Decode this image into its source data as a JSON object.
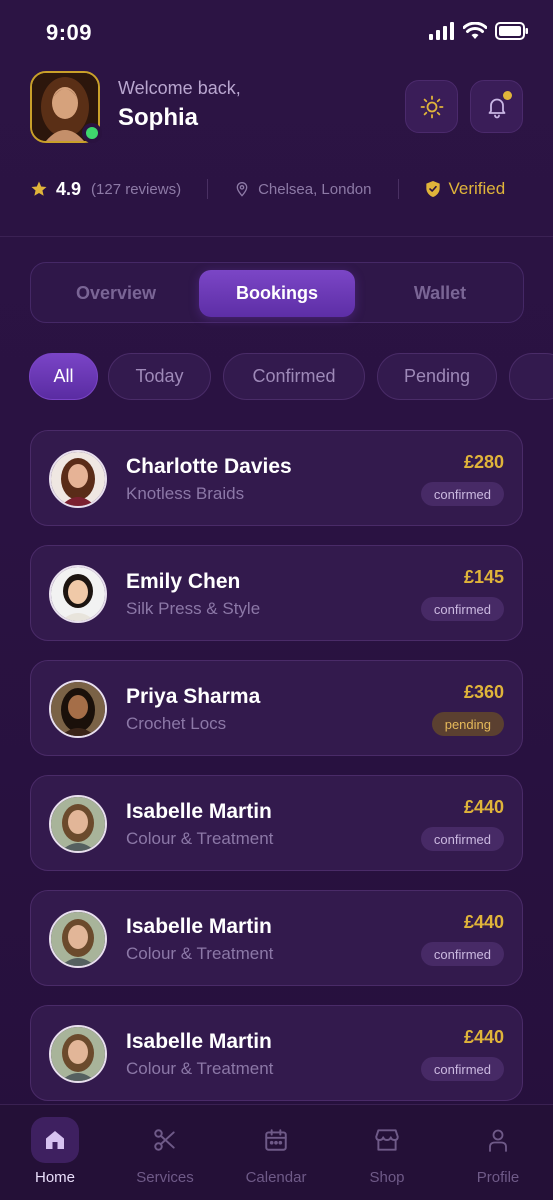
{
  "status_bar": {
    "time": "9:09"
  },
  "header": {
    "welcome": "Welcome back,",
    "name": "Sophia"
  },
  "stats": {
    "rating": "4.9",
    "reviews": "(127 reviews)",
    "location": "Chelsea, London",
    "verified": "Verified"
  },
  "tabs": [
    {
      "label": "Overview"
    },
    {
      "label": "Bookings"
    },
    {
      "label": "Wallet"
    }
  ],
  "active_tab": "Bookings",
  "filters": [
    {
      "label": "All"
    },
    {
      "label": "Today"
    },
    {
      "label": "Confirmed"
    },
    {
      "label": "Pending"
    }
  ],
  "bookings": [
    {
      "name": "Charlotte Davies",
      "service": "Knotless Braids",
      "price": "£280",
      "status": "confirmed"
    },
    {
      "name": "Emily Chen",
      "service": "Silk Press & Style",
      "price": "£145",
      "status": "confirmed"
    },
    {
      "name": "Priya Sharma",
      "service": "Crochet Locs",
      "price": "£360",
      "status": "pending"
    },
    {
      "name": "Isabelle Martin",
      "service": "Colour & Treatment",
      "price": "£440",
      "status": "confirmed"
    },
    {
      "name": "Isabelle Martin",
      "service": "Colour & Treatment",
      "price": "£440",
      "status": "confirmed"
    },
    {
      "name": "Isabelle Martin",
      "service": "Colour & Treatment",
      "price": "£440",
      "status": "confirmed"
    }
  ],
  "nav": [
    {
      "label": "Home",
      "icon": "home-icon"
    },
    {
      "label": "Services",
      "icon": "scissors-icon"
    },
    {
      "label": "Calendar",
      "icon": "calendar-icon"
    },
    {
      "label": "Shop",
      "icon": "shop-icon"
    },
    {
      "label": "Profile",
      "icon": "profile-icon"
    }
  ],
  "colors": {
    "background": "#2a1242",
    "accent": "#7b46c6",
    "gold": "#e0b43a",
    "online": "#3fd66d"
  }
}
